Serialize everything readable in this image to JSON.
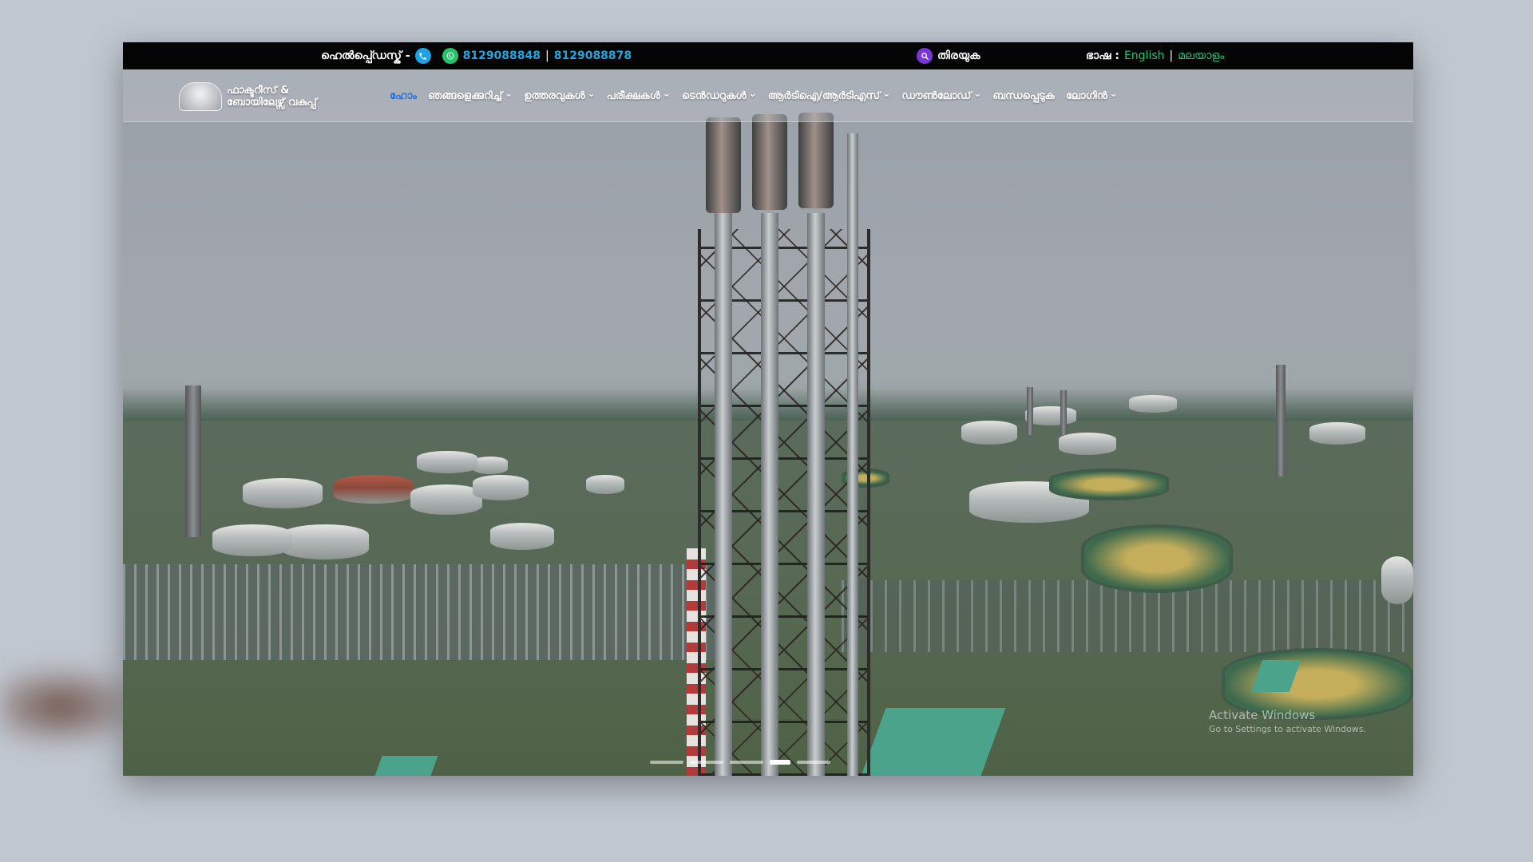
{
  "topbar": {
    "helpdesk_label": "ഹെൽപ്പ്ഡെസ്ക് -",
    "phone_primary": "8129088848",
    "phone_separator": "|",
    "phone_secondary": "8129088878",
    "search_label": "തിരയുക",
    "language_label": "ഭാഷ :",
    "language_options": [
      "English",
      "മലയാളം"
    ],
    "language_separator": "|"
  },
  "logo": {
    "line1": "ഫാക്ടറീസ് &",
    "line2": "ബോയിലേഴ്സ് വകുപ്പ്"
  },
  "nav": {
    "items": [
      {
        "label": "ഹോം",
        "active": true,
        "dropdown": false
      },
      {
        "label": "ഞങ്ങളെക്കുറിച്ച്",
        "active": false,
        "dropdown": true
      },
      {
        "label": "ഉത്തരവുകൾ",
        "active": false,
        "dropdown": true
      },
      {
        "label": "പരീക്ഷകൾ",
        "active": false,
        "dropdown": true
      },
      {
        "label": "ടെൻഡറുകൾ",
        "active": false,
        "dropdown": true
      },
      {
        "label": "ആർടിഐ/ആർടിഎസ്",
        "active": false,
        "dropdown": true
      },
      {
        "label": "ഡൗൺലോഡ്",
        "active": false,
        "dropdown": true
      },
      {
        "label": "ബന്ധപ്പെടുക",
        "active": false,
        "dropdown": false
      },
      {
        "label": "ലോഗിൻ",
        "active": false,
        "dropdown": true
      }
    ]
  },
  "hero": {
    "slides_count": 5,
    "active_slide": 4
  },
  "watermark": {
    "line1": "Activate Windows",
    "line2": "Go to Settings to activate Windows."
  },
  "colors": {
    "topbar_bg": "#050505",
    "phone_link": "#22a6e0",
    "language_link": "#1fc37a",
    "nav_active": "#1a73e8",
    "whatsapp": "#25c46a",
    "search_icon_bg": "#7a35d6"
  },
  "icons": {
    "phone": "phone-icon",
    "whatsapp": "whatsapp-icon",
    "search": "search-icon",
    "chevron": "chevron-down-icon"
  }
}
